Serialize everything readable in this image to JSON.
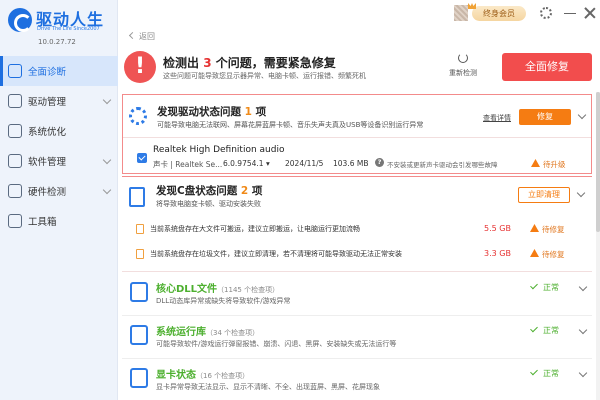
{
  "brand": {
    "name": "驱动人生",
    "slogan": "Drive The Life Since2007",
    "version": "10.0.27.72"
  },
  "nav": [
    {
      "label": "全面诊断",
      "icon": "diagnose-icon",
      "active": true
    },
    {
      "label": "驱动管理",
      "icon": "driver-icon",
      "expandable": true
    },
    {
      "label": "系统优化",
      "icon": "optimize-icon"
    },
    {
      "label": "软件管理",
      "icon": "software-icon",
      "expandable": true
    },
    {
      "label": "硬件检测",
      "icon": "hardware-icon",
      "expandable": true
    },
    {
      "label": "工具箱",
      "icon": "toolbox-icon"
    }
  ],
  "topbar": {
    "back_label": "返回",
    "vip_label": "终身会员"
  },
  "summary": {
    "title_prefix": "检测出",
    "count": "3",
    "title_suffix": "个问题，需要紧急修复",
    "subtitle": "这些问题可能导致您显示器异常、电脑卡顿、运行报错、频繁死机",
    "rescan_label": "重新检测",
    "fix_all_label": "全面修复"
  },
  "driver_issue": {
    "title_prefix": "发现驱动状态问题",
    "count": "1",
    "title_suffix": "项",
    "subtitle": "可能导致电脑无法联网、屏幕花屏蓝屏卡顿、音乐失声夫真及USB等设备识别运行异常",
    "detail_label": "查看详情",
    "fix_label": "修复",
    "device": {
      "name": "Realtek High Definition audio",
      "category": "声卡 | Realtek Se...",
      "version": "6.0.9754.1",
      "date": "2024/11/5",
      "size": "103.6 MB",
      "note": "不安装或更新声卡驱动会引发哪些故障",
      "status": "待升级"
    }
  },
  "cdisk_issue": {
    "title_prefix": "发现C盘状态问题",
    "count": "2",
    "title_suffix": "项",
    "subtitle": "将导致电脑变卡顿、驱动安装失败",
    "clean_label": "立即清理",
    "rows": [
      {
        "text": "当前系统盘存在大文件可搬运，建议立即搬运，让电脑运行更加流畅",
        "size": "5.5 GB",
        "status": "待修复"
      },
      {
        "text": "当前系统盘存在垃圾文件，建议立即清理，若不清理将可能导致驱动无法正常安装",
        "size": "3.3 GB",
        "status": "待修复"
      }
    ]
  },
  "ok_items": [
    {
      "title": "核心DLL文件",
      "count_text": "（1145 个检查项）",
      "subtitle": "DLL动态库异常或缺失将导致软件/游戏异常",
      "status": "正常"
    },
    {
      "title": "系统运行库",
      "count_text": "（34 个检查项）",
      "subtitle": "可能导致软件/游戏运行弹窗报错、崩溃、闪退、黑屏、安装缺失或无法运行等",
      "status": "正常"
    },
    {
      "title": "显卡状态",
      "count_text": "（16 个检查项）",
      "subtitle": "显卡异常导致无法显示、显示不清晰、不全、出现蓝屏、黑屏、花屏现象",
      "status": "正常"
    }
  ]
}
